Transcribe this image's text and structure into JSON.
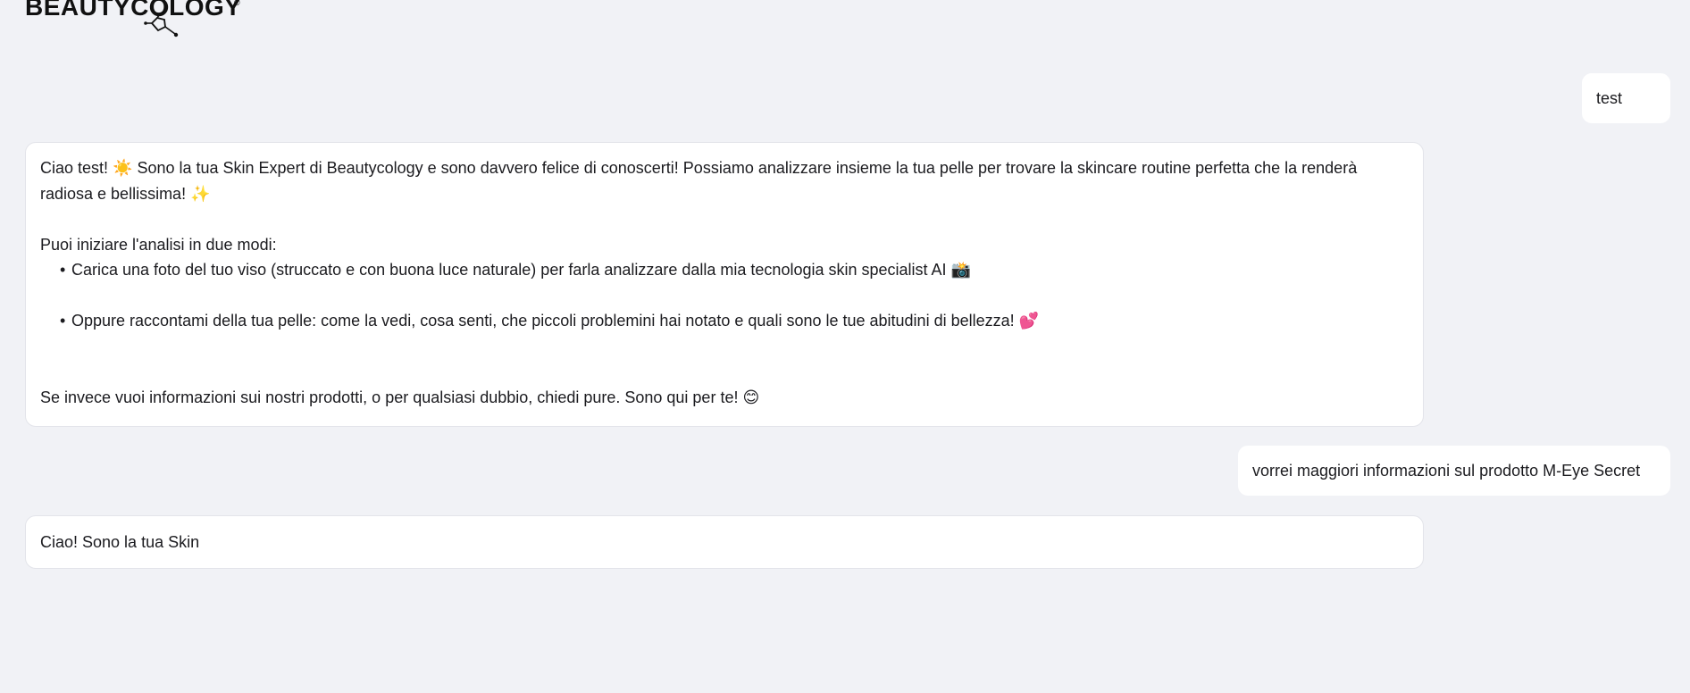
{
  "logo": {
    "text": "BEAUTYCOLOGY",
    "registered": "®"
  },
  "messages": [
    {
      "role": "user",
      "text": "test"
    },
    {
      "role": "assistant",
      "intro": "Ciao test! ☀️ Sono la tua Skin Expert di Beautycology e sono davvero felice di conoscerti! Possiamo analizzare insieme la tua pelle per trovare la skincare routine perfetta che la renderà",
      "intro_cont": "radiosa e bellissima! ✨",
      "lead": "Puoi iniziare l'analisi in due modi:",
      "bullets": [
        "Carica una foto del tuo viso (struccato e con buona luce naturale) per farla analizzare dalla mia tecnologia skin specialist AI 📸",
        "Oppure raccontami della tua pelle: come la vedi, cosa senti, che piccoli problemini hai notato e quali sono le tue abitudini di bellezza! 💕"
      ],
      "outro": "Se invece vuoi informazioni sui nostri prodotti, o per qualsiasi dubbio, chiedi pure. Sono qui per te! 😊"
    },
    {
      "role": "user",
      "text": "vorrei maggiori informazioni sul prodotto M-Eye Secret"
    },
    {
      "role": "assistant",
      "text": "Ciao! Sono la tua Skin"
    }
  ],
  "bullet_char": "•"
}
